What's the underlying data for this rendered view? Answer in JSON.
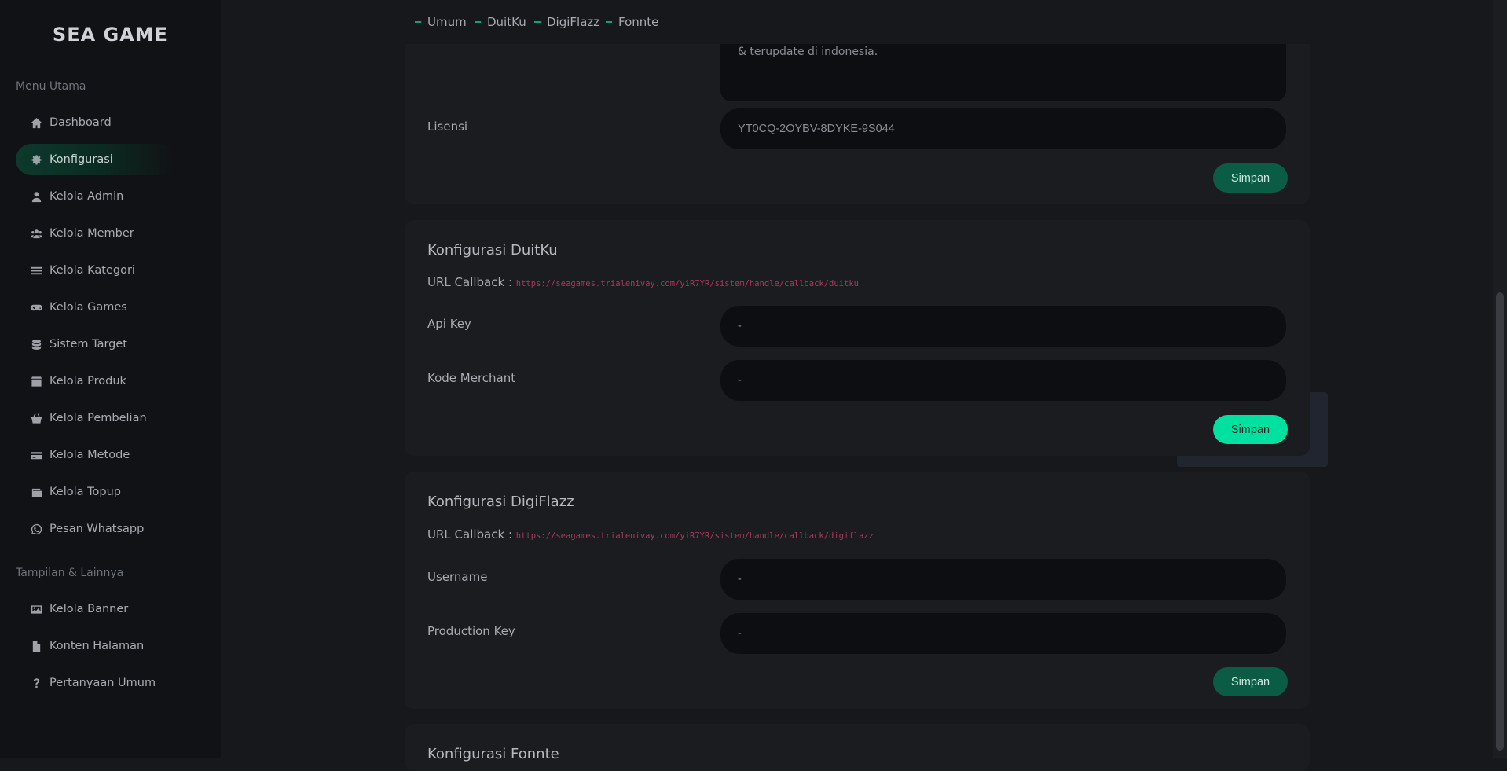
{
  "brand": "SEA GAME",
  "sidebar": {
    "section_main": "Menu Utama",
    "main_items": [
      {
        "label": "Dashboard",
        "icon": "home-icon"
      },
      {
        "label": "Konfigurasi",
        "icon": "gear-icon"
      },
      {
        "label": "Kelola Admin",
        "icon": "user-icon"
      },
      {
        "label": "Kelola Member",
        "icon": "users-icon"
      },
      {
        "label": "Kelola Kategori",
        "icon": "list-icon"
      },
      {
        "label": "Kelola Games",
        "icon": "gamepad-icon"
      },
      {
        "label": "Sistem Target",
        "icon": "database-icon"
      },
      {
        "label": "Kelola Produk",
        "icon": "box-icon"
      },
      {
        "label": "Kelola Pembelian",
        "icon": "basket-icon"
      },
      {
        "label": "Kelola Metode",
        "icon": "credit-card-icon"
      },
      {
        "label": "Kelola Topup",
        "icon": "wallet-icon"
      },
      {
        "label": "Pesan Whatsapp",
        "icon": "whatsapp-icon"
      }
    ],
    "section_other": "Tampilan & Lainnya",
    "other_items": [
      {
        "label": "Kelola Banner",
        "icon": "image-icon"
      },
      {
        "label": "Konten Halaman",
        "icon": "file-icon"
      },
      {
        "label": "Pertanyaan Umum",
        "icon": "question-icon"
      }
    ],
    "active": "Konfigurasi"
  },
  "tabs": [
    "Umum",
    "DuitKu",
    "DigiFlazz",
    "Fonnte"
  ],
  "umum": {
    "textarea_fragment": "& terupdate di indonesia.",
    "license_label": "Lisensi",
    "license_value": "YT0CQ-2OYBV-8DYKE-9S044",
    "save": "Simpan"
  },
  "duitku": {
    "title": "Konfigurasi DuitKu",
    "callback_label": "URL Callback :",
    "callback_url": "https://seagames.trialenivay.com/yiR7YR/sistem/handle/callback/duitku",
    "api_key_label": "Api Key",
    "api_key_value": "-",
    "merchant_label": "Kode Merchant",
    "merchant_value": "-",
    "save": "Simpan"
  },
  "digiflazz": {
    "title": "Konfigurasi DigiFlazz",
    "callback_label": "URL Callback :",
    "callback_url": "https://seagames.trialenivay.com/yiR7YR/sistem/handle/callback/digiflazz",
    "username_label": "Username",
    "username_value": "-",
    "prodkey_label": "Production Key",
    "prodkey_value": "-",
    "save": "Simpan"
  },
  "fonnte": {
    "title": "Konfigurasi Fonnte"
  },
  "colors": {
    "accent": "#00e0a0",
    "accent_dark": "#0a5c45",
    "callback_url": "#a83b5a"
  }
}
